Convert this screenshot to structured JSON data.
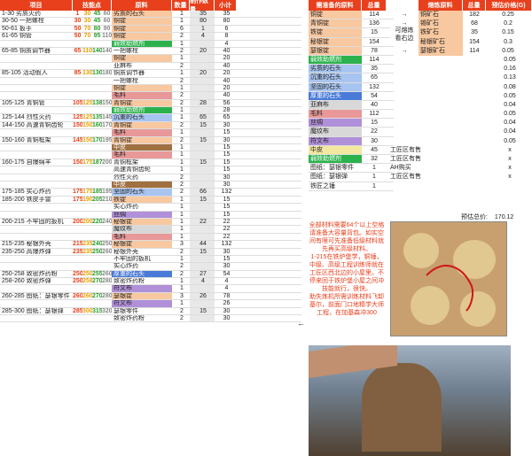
{
  "headers": {
    "item": "项目",
    "skill": "技能点",
    "mat": "原料",
    "qty": "数量",
    "make": "制作数量",
    "sub": "小计",
    "need": "需准备的原料",
    "total": "总量",
    "smelt": "熔炼原料",
    "total2": "总量",
    "price": "预估价格(G)"
  },
  "rows": [
    {
      "name": "1-30 劣质火药",
      "lv": [
        "1",
        "30",
        "45",
        "60"
      ],
      "mats": [
        [
          "劣质的石头",
          "bg-orange",
          "1",
          "35"
        ]
      ],
      "make": "35"
    },
    {
      "name": "30-50 一把螺栓",
      "lv": [
        "30",
        "30",
        "45",
        "60"
      ],
      "mats": [
        [
          "铜锭",
          "bg-orange",
          "1",
          "80"
        ]
      ],
      "make": "80"
    },
    {
      "name": "50-61 扳手",
      "lv": [
        "50",
        "70",
        "80",
        "90"
      ],
      "mats": [
        [
          "铜锭",
          "bg-orange",
          "6",
          "6"
        ]
      ],
      "make": "1"
    },
    {
      "name": "61-65 铜管",
      "lv": [
        "50",
        "70",
        "95",
        "110"
      ],
      "mats": [
        [
          "铜锭",
          "bg-orange",
          "2",
          "8"
        ],
        [
          "弱效助燃剂",
          "bg-green",
          "1",
          "4"
        ]
      ],
      "make": "4"
    },
    {
      "name": "65-85 铜质调节器",
      "lv": [
        "65",
        "110",
        "140",
        "140"
      ],
      "mats": [
        [
          "一把螺栓",
          "",
          "2",
          "40"
        ],
        [
          "铜锭",
          "bg-orange",
          "1",
          "20"
        ],
        [
          "亚麻布",
          "",
          "2",
          "40"
        ]
      ],
      "make": "20"
    },
    {
      "name": "85-105 活动假人",
      "lv": [
        "85",
        "130",
        "130",
        "180"
      ],
      "mats": [
        [
          "铜质调节器",
          "",
          "1",
          "20"
        ],
        [
          "一把螺栓",
          "",
          "2",
          "40"
        ],
        [
          "铜锭",
          "bg-orange",
          "1",
          "20"
        ],
        [
          "毛料",
          "bg-red",
          "2",
          "40"
        ]
      ],
      "make": "20"
    },
    {
      "name": "105-125 青铜管",
      "lv": [
        "105",
        "125",
        "138",
        "150"
      ],
      "mats": [
        [
          "青铜锭",
          "bg-orange",
          "2",
          "56"
        ],
        [
          "弱效助燃剂",
          "bg-green",
          "1",
          "28"
        ]
      ],
      "make": "28"
    },
    {
      "name": "125-144 烈性火药",
      "lv": [
        "125",
        "125",
        "135",
        "145"
      ],
      "mats": [
        [
          "沉重的石头",
          "bg-blue",
          "1",
          "65"
        ]
      ],
      "make": "65"
    },
    {
      "name": "144-150 高速青铜齿轮",
      "lv": [
        "150",
        "150",
        "160",
        "170"
      ],
      "mats": [
        [
          "青铜锭",
          "bg-orange",
          "2",
          "30"
        ],
        [
          "毛料",
          "bg-red",
          "1",
          "15"
        ]
      ],
      "make": "15"
    },
    {
      "name": "150-160 青铜框架",
      "lv": [
        "145",
        "150",
        "170",
        "195"
      ],
      "mats": [
        [
          "青铜锭",
          "bg-orange",
          "2",
          "30"
        ],
        [
          "中皮",
          "bg-brown",
          "1",
          "15"
        ],
        [
          "毛料",
          "bg-red",
          "1",
          "15"
        ]
      ],
      "make": "15"
    },
    {
      "name": "160-175 自爆绵羊",
      "lv": [
        "150",
        "175",
        "187",
        "200"
      ],
      "mats": [
        [
          "青铜框架",
          "",
          "1",
          "15"
        ],
        [
          "高速青铜齿轮",
          "",
          "1",
          "15"
        ],
        [
          "烈性火药",
          "",
          "2",
          "30"
        ],
        [
          "中皮",
          "bg-brown",
          "2",
          "30"
        ]
      ],
      "make": "15"
    },
    {
      "name": "175-185 实心炸药",
      "lv": [
        "175",
        "175",
        "185",
        "195"
      ],
      "mats": [
        [
          "坚固的石头",
          "bg-blue",
          "2",
          "132"
        ]
      ],
      "make": "66"
    },
    {
      "name": "185-200 铁皮手雷",
      "lv": [
        "175",
        "190",
        "205",
        "210"
      ],
      "mats": [
        [
          "铁锭",
          "bg-orange",
          "1",
          "15"
        ],
        [
          "实心炸药",
          "",
          "1",
          "15"
        ],
        [
          "丝绸",
          "bg-purple",
          "1",
          "15"
        ]
      ],
      "make": "15"
    },
    {
      "name": "200-215 不牢固的扳机",
      "lv": [
        "200",
        "200",
        "220",
        "240"
      ],
      "mats": [
        [
          "秘银锭",
          "bg-orange",
          "1",
          "22"
        ],
        [
          "魔纹布",
          "bg-grey",
          "1",
          "22"
        ],
        [
          "毛料",
          "bg-red",
          "1",
          "22"
        ]
      ],
      "make": "22"
    },
    {
      "name": "215-235 秘银外壳",
      "lv": [
        "215",
        "235",
        "240",
        "250"
      ],
      "mats": [
        [
          "秘银锭",
          "bg-orange",
          "3",
          "132"
        ]
      ],
      "make": "44"
    },
    {
      "name": "235-250 高爆炸弹",
      "lv": [
        "235",
        "235",
        "250",
        "260"
      ],
      "mats": [
        [
          "秘银外壳",
          "",
          "2",
          "30"
        ],
        [
          "不牢固的扳机",
          "",
          "1",
          "15"
        ],
        [
          "实心炸药",
          "",
          "2",
          "30"
        ]
      ],
      "make": "15"
    },
    {
      "name": "250-258 致密炸药粉",
      "lv": [
        "250",
        "250",
        "255",
        "260"
      ],
      "mats": [
        [
          "厚重的石头",
          "bg-darkblue",
          "2",
          "54"
        ]
      ],
      "make": "27"
    },
    {
      "name": "258-260 致密炸弹",
      "lv": [
        "250",
        "258",
        "270",
        "280"
      ],
      "mats": [
        [
          "致密炸药粉",
          "",
          "1",
          "4"
        ],
        [
          "符文布",
          "bg-purple",
          "1",
          "4"
        ]
      ],
      "make": "4"
    },
    {
      "name": "260-285 图纸：瑟银零件",
      "lv": [
        "260",
        "260",
        "270",
        "280"
      ],
      "mats": [
        [
          "瑟银锭",
          "bg-orange",
          "3",
          "78"
        ],
        [
          "符文布",
          "bg-purple",
          "1",
          "26"
        ]
      ],
      "make": "26"
    },
    {
      "name": "285-300 图纸：瑟银弹",
      "lv": [
        "285",
        "300",
        "315",
        "320"
      ],
      "mats": [
        [
          "瑟银零件",
          "",
          "2",
          "30"
        ],
        [
          "致密炸药粉",
          "",
          "2",
          "30"
        ]
      ],
      "make": "15"
    }
  ],
  "need": [
    [
      "铜锭",
      "bg-orange",
      "114"
    ],
    [
      "青铜锭",
      "bg-orange",
      "136"
    ],
    [
      "铁锭",
      "bg-orange",
      "15"
    ],
    [
      "秘银锭",
      "bg-orange",
      "154"
    ],
    [
      "瑟银锭",
      "bg-orange",
      "78"
    ],
    [
      "弱效助燃剂",
      "bg-green",
      "114"
    ],
    [
      "劣质的石头",
      "bg-blue",
      "35"
    ],
    [
      "沉重的石头",
      "bg-blue",
      "65"
    ],
    [
      "坚固的石头",
      "bg-blue",
      "132"
    ],
    [
      "厚重的石头",
      "bg-darkblue",
      "54"
    ],
    [
      "亚麻布",
      "bg-grey",
      "40"
    ],
    [
      "毛料",
      "bg-red",
      "112"
    ],
    [
      "丝绸",
      "bg-purple",
      "15"
    ],
    [
      "魔纹布",
      "bg-grey",
      "22"
    ],
    [
      "符文布",
      "bg-purple",
      "30"
    ],
    [
      "中皮",
      "bg-yellow",
      "45"
    ],
    [
      "弱效助燃剂",
      "bg-green",
      "32"
    ],
    [
      "图纸：瑟银零件",
      "",
      "1"
    ],
    [
      "图纸：瑟银弹",
      "",
      "1"
    ],
    [
      "铁匠之锤",
      "",
      "1"
    ]
  ],
  "smelt": [
    [
      "铜矿石",
      "182",
      "0.25"
    ],
    [
      "锡矿石",
      "68",
      "0.2"
    ],
    [
      "铁矿石",
      "35",
      "0.15"
    ],
    [
      "秘银矿石",
      "154",
      "0.3"
    ],
    [
      "瑟银矿石",
      "114",
      "0.05"
    ]
  ],
  "smelt_note": "可熔炼\n看右边",
  "prices": [
    "0.05",
    "0.16",
    "0.13",
    "0.08",
    "0.05",
    "0.04",
    "0.05",
    "0.04",
    "0.04",
    "0.05",
    "x",
    "x",
    "x",
    "x"
  ],
  "price_notes": [
    "工匠区有售",
    "工匠区有售",
    "AH购买",
    "工匠区有售"
  ],
  "estimate_label": "预估总价:",
  "estimate_value": "170.12",
  "notice": "全部材料需要64个以上空格请准备大容量背包。如实空间有限可先准备低级材料就先再买高级材料。\n1-215在铁炉堡学，铜锤，中级、高级工程训练师就在工匠区西北边的小屋里。不停来回于铁炉堡小屋之间冲技能就行，很快。\n助失炼机所需训练材料飞卸基尔，前面门口地精学大师工程，在加基森冲300",
  "arrow": "←"
}
